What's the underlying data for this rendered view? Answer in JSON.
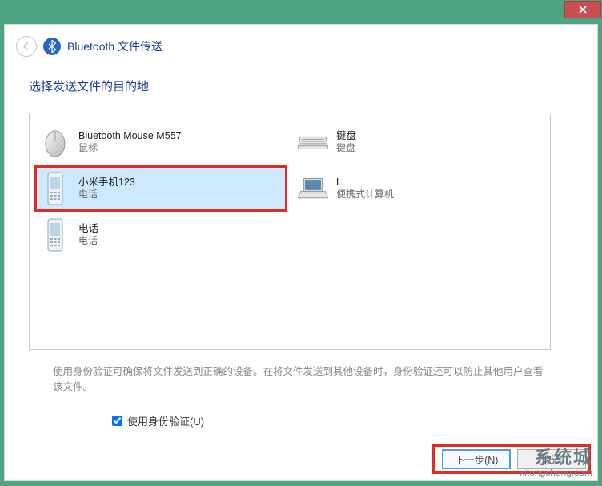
{
  "window": {
    "title": "Bluetooth 文件传送"
  },
  "instruction": "选择发送文件的目的地",
  "devices": [
    {
      "name": "Bluetooth Mouse M557",
      "type": "鼠标",
      "icon": "mouse"
    },
    {
      "name": "键盘",
      "type": "键盘",
      "icon": "keyboard"
    },
    {
      "name": "小米手机123",
      "type": "电话",
      "icon": "phone",
      "selected": true,
      "highlighted": true
    },
    {
      "name": "L",
      "type": "便携式计算机",
      "icon": "laptop"
    },
    {
      "name": "电话",
      "type": "电话",
      "icon": "phone"
    }
  ],
  "hint": "使用身份验证可确保将文件发送到正确的设备。在将文件发送到其他设备时，身份验证还可以防止其他用户查看该文件。",
  "auth_checkbox": {
    "label": "使用身份验证(U)",
    "checked": true
  },
  "buttons": {
    "next": "下一步(N)",
    "cancel": "取消"
  },
  "watermark": {
    "line1": "系统城",
    "line2": "xitongcheng.com"
  }
}
